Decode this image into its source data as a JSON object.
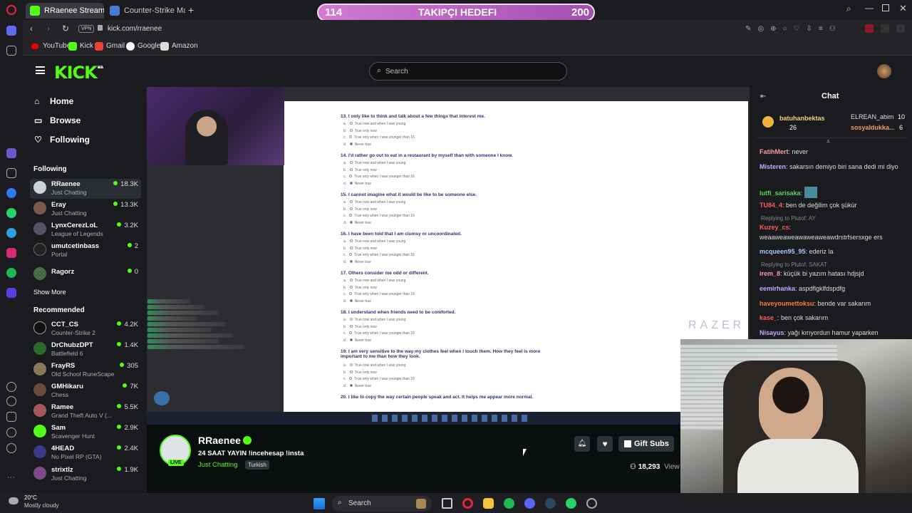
{
  "browser": {
    "tabs": [
      {
        "label": "RRaenee Stream - Wa",
        "active": true
      },
      {
        "label": "Counter-Strike Matches &",
        "active": false
      }
    ],
    "url": "kick.com/rraenee",
    "vpn_badge": "VPN",
    "bookmarks": [
      "YouTube",
      "Kick",
      "Gmail",
      "Google",
      "Amazon"
    ]
  },
  "goal": {
    "current": "114",
    "label": "TAKIPÇI HEDEFI",
    "target": "200"
  },
  "kick": {
    "logo": "KICK",
    "logo_badge": "BETA",
    "search_placeholder": "Search",
    "nav": [
      "Home",
      "Browse",
      "Following"
    ],
    "following_title": "Following",
    "following": [
      {
        "name": "RRaenee",
        "category": "Just Chatting",
        "viewers": "18.3K"
      },
      {
        "name": "Eray",
        "category": "Just Chatting",
        "viewers": "13.3K"
      },
      {
        "name": "LynxCerezLoL",
        "category": "League of Legends",
        "viewers": "3.2K"
      },
      {
        "name": "umutcetinbass",
        "category": "Portal",
        "viewers": "2"
      },
      {
        "name": "Ragorz",
        "category": "",
        "viewers": "0"
      }
    ],
    "show_more": "Show More",
    "recommended_title": "Recommended",
    "recommended": [
      {
        "name": "CCT_CS",
        "category": "Counter-Strike 2",
        "viewers": "4.2K"
      },
      {
        "name": "DrChubzDPT",
        "category": "Battlefield 6",
        "viewers": "1.4K"
      },
      {
        "name": "FrayRS",
        "category": "Old School RuneScape",
        "viewers": "305"
      },
      {
        "name": "GMHikaru",
        "category": "Chess",
        "viewers": "7K"
      },
      {
        "name": "Ramee",
        "category": "Grand Theft Auto V (...",
        "viewers": "5.5K"
      },
      {
        "name": "Sam",
        "category": "Scavenger Hunt",
        "viewers": "2.9K"
      },
      {
        "name": "4HEAD",
        "category": "No Pixel RP (GTA)",
        "viewers": "2.4K"
      },
      {
        "name": "strixtlz",
        "category": "Just Chatting",
        "viewers": "1.9K"
      }
    ]
  },
  "questionnaire": [
    {
      "q": "13. I only like to think and talk about a few things that interest me."
    },
    {
      "q": "14. I'd rather go out to eat in a restaurant by myself than with someone I know."
    },
    {
      "q": "15. I cannot imagine what it would be like to be someone else."
    },
    {
      "q": "16. I have been told that I am clumsy or uncoordinated."
    },
    {
      "q": "17. Others consider me odd or different."
    },
    {
      "q": "18. I understand when friends need to be comforted."
    },
    {
      "q": "19. I am very sensitive to the way my clothes feel when I touch them. How they feel is more important to me than how they look."
    },
    {
      "q": "20. I like to copy the way certain people speak and act. It helps me appear more normal."
    }
  ],
  "options": [
    "True now and when I was young",
    "True only now",
    "True only when I was younger than 16",
    "Never true"
  ],
  "option_letters": [
    "a.",
    "b.",
    "c.",
    "d."
  ],
  "watermark": "RAZER",
  "stream": {
    "streamer": "RRaenee",
    "title": "24 SAAT YAYIN !incehesap !insta",
    "category": "Just Chatting",
    "tag": "Turkish",
    "live_badge": "LIVE",
    "viewers": "18,293",
    "viewers_suffix": "View",
    "gift_subs": "Gift Subs"
  },
  "chat": {
    "title": "Chat",
    "pinned": [
      {
        "name": "batuhanbektas",
        "count": "26"
      },
      {
        "name": "ELREAN_abim",
        "count": "10"
      },
      {
        "name": "sosyaldukka...",
        "count": "6"
      }
    ],
    "messages": [
      {
        "user": "FatihMert",
        "text": ": never",
        "color": "#f0a0a0"
      },
      {
        "user": "Misteren",
        "text": ": sakarsın demiyo biri sana dedi mi diyo",
        "color": "#c8a8ff"
      },
      {
        "user": "lutfi_sarisaka",
        "text": ":",
        "color": "#5ad35a"
      },
      {
        "user": "TU84_4",
        "text": ": ben de değilim çok şükür",
        "color": "#ff5a5a"
      },
      {
        "user": "Kuzey_cs",
        "text": ":",
        "color": "#ff5a5a",
        "reply": "Replying to Plutof: AY"
      },
      {
        "user": "",
        "text": "weaaweaweawaweaweawdrstrfsersxge ers",
        "color": "#ddd"
      },
      {
        "user": "mcqueen95_95",
        "text": ": ederiz la",
        "color": "#a8c8ff"
      },
      {
        "user": "irem_8",
        "text": ": küçük bi yazım hatası hdjsjd",
        "color": "#ff8fd0",
        "reply": "Replying to Plutof: SAKAT"
      },
      {
        "user": "eemirhanka",
        "text": ": aspdflgklfdspdfg",
        "color": "#c8a8ff"
      },
      {
        "user": "haveyoumettoksu",
        "text": ": bende var sakarım",
        "color": "#ff7a3a"
      },
      {
        "user": "kase_",
        "text": ": ben çok sakarım",
        "color": "#ff5a5a"
      },
      {
        "user": "Nisayus",
        "text": ": yağı kırıyordun hamur yaparken",
        "color": "#c8a8ff"
      }
    ]
  },
  "weather": {
    "temp": "20°C",
    "desc": "Mostly cloudy"
  },
  "taskbar_search": "Search"
}
